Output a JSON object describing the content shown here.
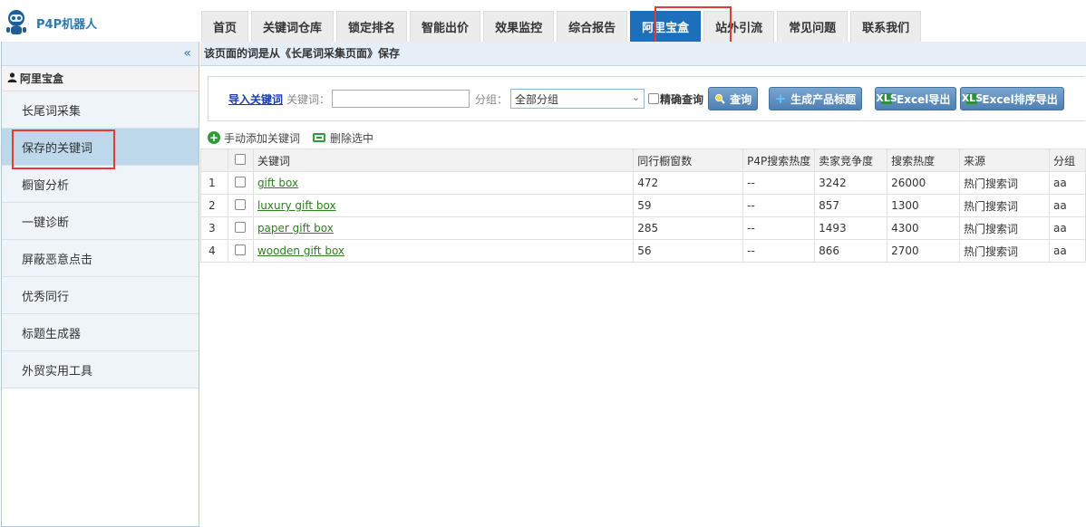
{
  "app": {
    "logo_text": "P4P机器人"
  },
  "nav": [
    {
      "label": "首页"
    },
    {
      "label": "关键词仓库"
    },
    {
      "label": "锁定排名"
    },
    {
      "label": "智能出价"
    },
    {
      "label": "效果监控"
    },
    {
      "label": "综合报告"
    },
    {
      "label": "阿里宝盒",
      "active": true
    },
    {
      "label": "站外引流"
    },
    {
      "label": "常见问题"
    },
    {
      "label": "联系我们"
    }
  ],
  "sidebar": {
    "collapse_glyph": "«",
    "header": "阿里宝盒",
    "items": [
      {
        "label": "长尾词采集"
      },
      {
        "label": "保存的关键词",
        "active": true
      },
      {
        "label": "橱窗分析"
      },
      {
        "label": "一键诊断"
      },
      {
        "label": "屏蔽恶意点击"
      },
      {
        "label": "优秀同行"
      },
      {
        "label": "标题生成器"
      },
      {
        "label": "外贸实用工具"
      }
    ]
  },
  "main": {
    "info": "该页面的词是从《长尾词采集页面》保存",
    "toolbar": {
      "import_link": "导入关键词",
      "keyword_label": "关键词：",
      "keyword_value": "",
      "group_label": "分组：",
      "group_selected": "全部分组",
      "exact_label": "精确查询",
      "query_btn": "查询",
      "gen_title_btn": "生成产品标题",
      "excel_btn": "Excel导出",
      "excel_sort_btn": "Excel排序导出"
    },
    "actions": {
      "add": "手动添加关键词",
      "delete": "删除选中"
    },
    "table": {
      "headers": [
        "关键词",
        "同行橱窗数",
        "P4P搜索热度",
        "卖家竞争度",
        "搜索热度",
        "来源",
        "分组"
      ],
      "rows": [
        {
          "idx": "1",
          "keyword": "gift box",
          "windows": "472",
          "p4p": "--",
          "competition": "3242",
          "heat": "26000",
          "source": "热门搜索词",
          "group": "aa"
        },
        {
          "idx": "2",
          "keyword": "luxury gift box",
          "windows": "59",
          "p4p": "--",
          "competition": "857",
          "heat": "1300",
          "source": "热门搜索词",
          "group": "aa"
        },
        {
          "idx": "3",
          "keyword": "paper gift box",
          "windows": "285",
          "p4p": "--",
          "competition": "1493",
          "heat": "4300",
          "source": "热门搜索词",
          "group": "aa"
        },
        {
          "idx": "4",
          "keyword": "wooden gift box",
          "windows": "56",
          "p4p": "--",
          "competition": "866",
          "heat": "2700",
          "source": "热门搜索词",
          "group": "aa"
        }
      ]
    }
  },
  "colors": {
    "accent": "#1c6fb8",
    "highlight": "#e53935",
    "link_green": "#2e7d1f"
  }
}
